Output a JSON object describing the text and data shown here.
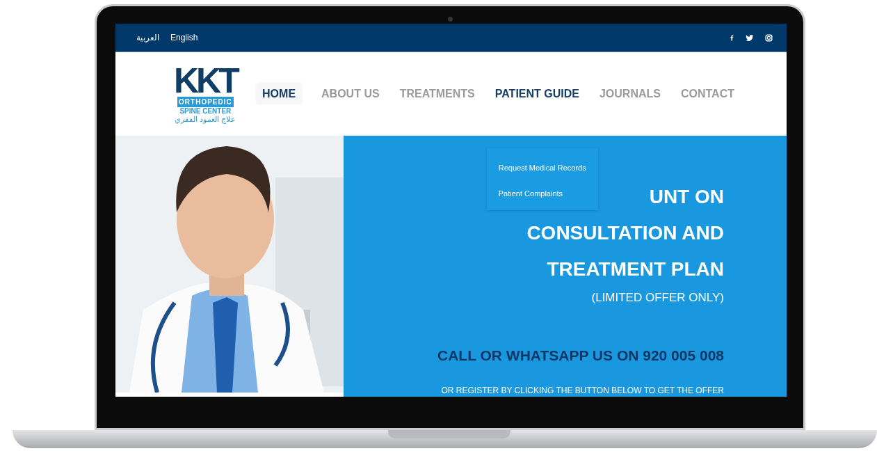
{
  "topbar": {
    "languages": [
      {
        "label": "العربية"
      },
      {
        "label": "English"
      }
    ],
    "social": [
      {
        "kind": "facebook"
      },
      {
        "kind": "twitter"
      },
      {
        "kind": "instagram"
      }
    ]
  },
  "logo": {
    "wordmark": "KKT",
    "band": "ORTHOPEDIC",
    "subtitle": "SPINE CENTER",
    "arabic": "علاج العمود الفقري"
  },
  "nav": [
    {
      "label": "HOME",
      "selected": true,
      "hovered": false
    },
    {
      "label": "ABOUT US",
      "selected": false,
      "hovered": false
    },
    {
      "label": "TREATMENTS",
      "selected": false,
      "hovered": false
    },
    {
      "label": "PATIENT GUIDE",
      "selected": false,
      "hovered": true,
      "submenu": [
        "Request Medical Records",
        "Patient Complaints"
      ]
    },
    {
      "label": "JOURNALS",
      "selected": false,
      "hovered": false
    },
    {
      "label": "CONTACT",
      "selected": false,
      "hovered": false
    }
  ],
  "hero": {
    "headline": [
      "UNT ON",
      "CONSULTATION AND",
      "TREATMENT PLAN"
    ],
    "note": "(LIMITED OFFER ONLY)",
    "call": "CALL OR WHATSAPP US ON 920 005 008",
    "register": "OR REGISTER BY CLICKING THE BUTTON BELOW TO GET THE OFFER"
  }
}
